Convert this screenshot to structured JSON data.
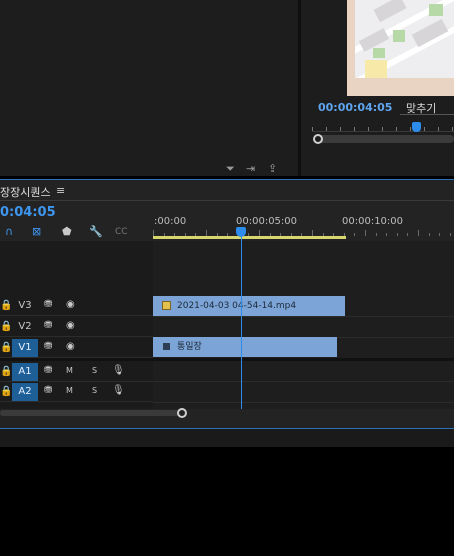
{
  "program_monitor": {
    "timecode": "00:00:04:05",
    "fit_label": "맞추기",
    "playhead_fraction": 0.7
  },
  "source_controls": {
    "filter_icon": "filter-icon",
    "insert_icon": "insert-icon",
    "export_icon": "export-icon"
  },
  "timeline": {
    "sequence_tab": "장장시퀀스",
    "menu_glyph": "≡",
    "timecode": "0:04:05",
    "tools": [
      "snap-icon",
      "linked-selection-icon",
      "marker-icon",
      "wrench-icon",
      "captions-icon"
    ],
    "ruler_labels": [
      ":00:00",
      "00:00:05:00",
      "00:00:10:00"
    ],
    "tracks": [
      {
        "lock": "🔒",
        "name": "V3",
        "icons": [
          "⛃",
          "◉"
        ],
        "active": false
      },
      {
        "lock": "🔒",
        "name": "V2",
        "icons": [
          "⛃",
          "◉"
        ],
        "active": false
      },
      {
        "lock": "🔒",
        "name": "V1",
        "icons": [
          "⛃",
          "◉"
        ],
        "active": true
      },
      {
        "lock": "🔒",
        "name": "A1",
        "icons": [
          "⛃",
          "M",
          "S",
          "🎙"
        ],
        "active": true
      },
      {
        "lock": "🔒",
        "name": "A2",
        "icons": [
          "⛃",
          "M",
          "S",
          "🎙"
        ],
        "active": true
      }
    ],
    "clips": [
      {
        "track": "V3",
        "label": "2021-04-03 04-54-14.mp4"
      },
      {
        "track": "V1",
        "label": "통일장"
      }
    ]
  }
}
